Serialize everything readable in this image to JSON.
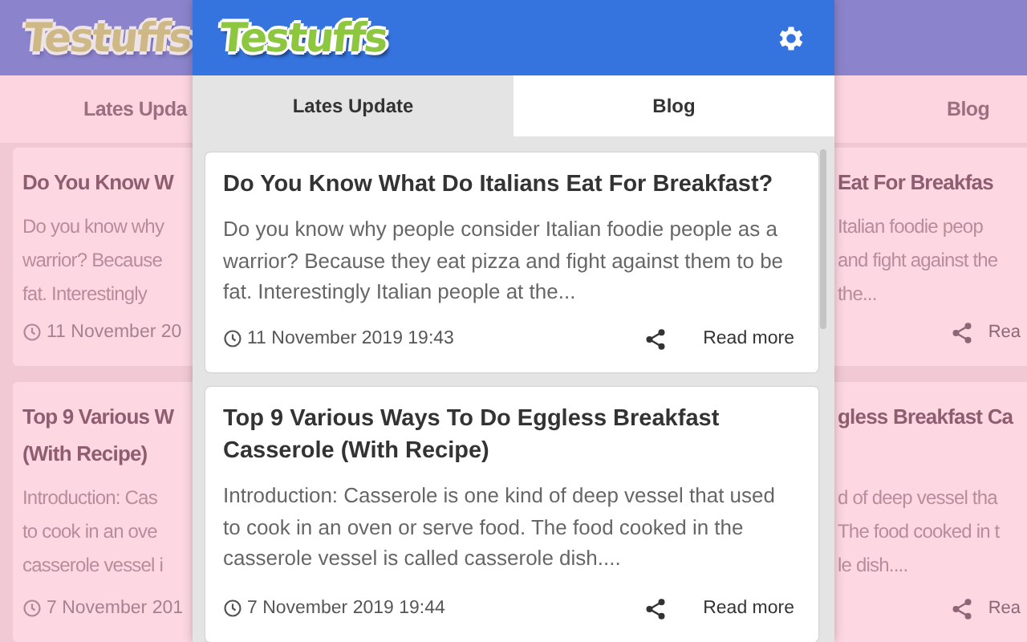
{
  "popup": {
    "logo": "Testuffs",
    "tabs": [
      {
        "label": "Lates Update",
        "selected": true
      },
      {
        "label": "Blog",
        "selected": false
      }
    ],
    "posts": [
      {
        "title": "Do You Know What Do Italians Eat For Breakfast?",
        "excerpt": "Do you know why people consider Italian foodie people as a warrior? Because they eat pizza and fight against them to be fat. Interestingly Italian people at the...",
        "date": "11 November 2019 19:43",
        "action": "Read more"
      },
      {
        "title": "Top 9 Various Ways To Do Eggless Breakfast Casserole (With Recipe)",
        "excerpt": "Introduction: Casserole is one kind of deep vessel that used to cook in an oven or serve food. The food cooked in the casserole vessel is called casserole dish....",
        "date": "7 November 2019 19:44",
        "action": "Read more"
      }
    ]
  },
  "backdrop": {
    "left": {
      "logo": "Testuffs",
      "tab": "Lates Upda"
    },
    "right": {
      "tab": "Blog"
    },
    "posts": [
      {
        "left": {
          "title_lines": [
            "Do You Know W"
          ],
          "excerpt_lines": [
            "Do you know why",
            "warrior? Because",
            "fat. Interestingly"
          ],
          "date": "11 November 20"
        },
        "right": {
          "title_lines": [
            "Eat For Breakfas"
          ],
          "excerpt_lines": [
            "Italian foodie peop",
            "and fight against the",
            "the..."
          ],
          "action": "Rea"
        }
      },
      {
        "left": {
          "title_lines": [
            "Top 9 Various W",
            "(With Recipe)"
          ],
          "excerpt_lines": [
            "Introduction: Cas",
            "to cook in an ove",
            "casserole vessel i"
          ],
          "date": "7 November 201"
        },
        "right": {
          "title_lines": [
            "gless Breakfast Ca"
          ],
          "excerpt_lines": [
            "d of deep vessel tha",
            "The food cooked in t",
            "le dish...."
          ],
          "action": "Rea"
        }
      }
    ]
  }
}
